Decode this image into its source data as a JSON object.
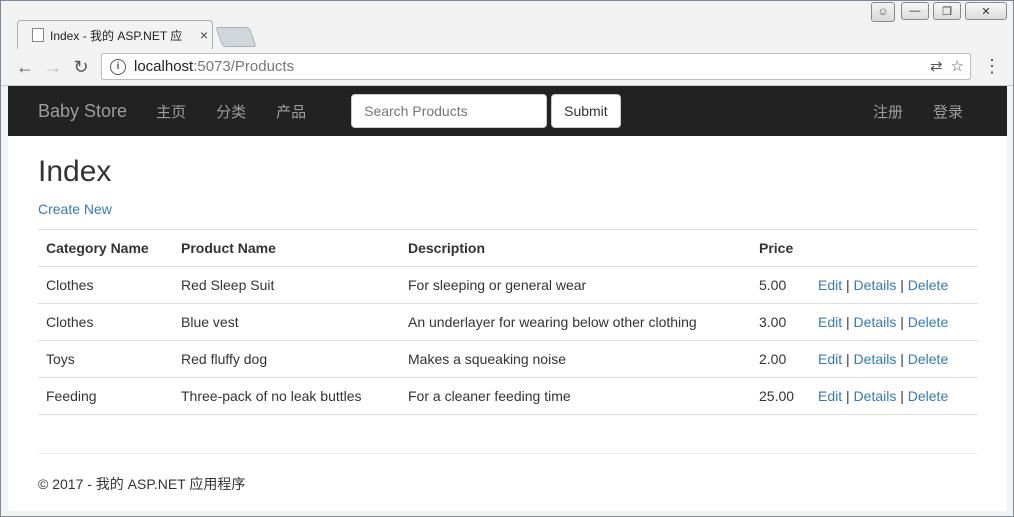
{
  "browser": {
    "tab_title": "Index - 我的 ASP.NET 应",
    "url_host": "localhost",
    "url_rest": ":5073/Products"
  },
  "navbar": {
    "brand": "Baby Store",
    "links": [
      "主页",
      "分类",
      "产品"
    ],
    "search_placeholder": "Search Products",
    "submit_label": "Submit",
    "right_links": [
      "注册",
      "登录"
    ]
  },
  "page": {
    "heading": "Index",
    "create_new": "Create New"
  },
  "table": {
    "headers": [
      "Category Name",
      "Product Name",
      "Description",
      "Price",
      ""
    ],
    "rows": [
      {
        "category": "Clothes",
        "product": "Red Sleep Suit",
        "description": "For sleeping or general wear",
        "price": "5.00"
      },
      {
        "category": "Clothes",
        "product": "Blue vest",
        "description": "An underlayer for wearing below other clothing",
        "price": "3.00"
      },
      {
        "category": "Toys",
        "product": "Red fluffy dog",
        "description": "Makes a squeaking noise",
        "price": "2.00"
      },
      {
        "category": "Feeding",
        "product": "Three-pack of no leak buttles",
        "description": "For a cleaner feeding time",
        "price": "25.00"
      }
    ],
    "actions": {
      "edit": "Edit",
      "details": "Details",
      "delete": "Delete",
      "separator": "|"
    }
  },
  "footer": {
    "text": "© 2017 - 我的 ASP.NET 应用程序"
  }
}
